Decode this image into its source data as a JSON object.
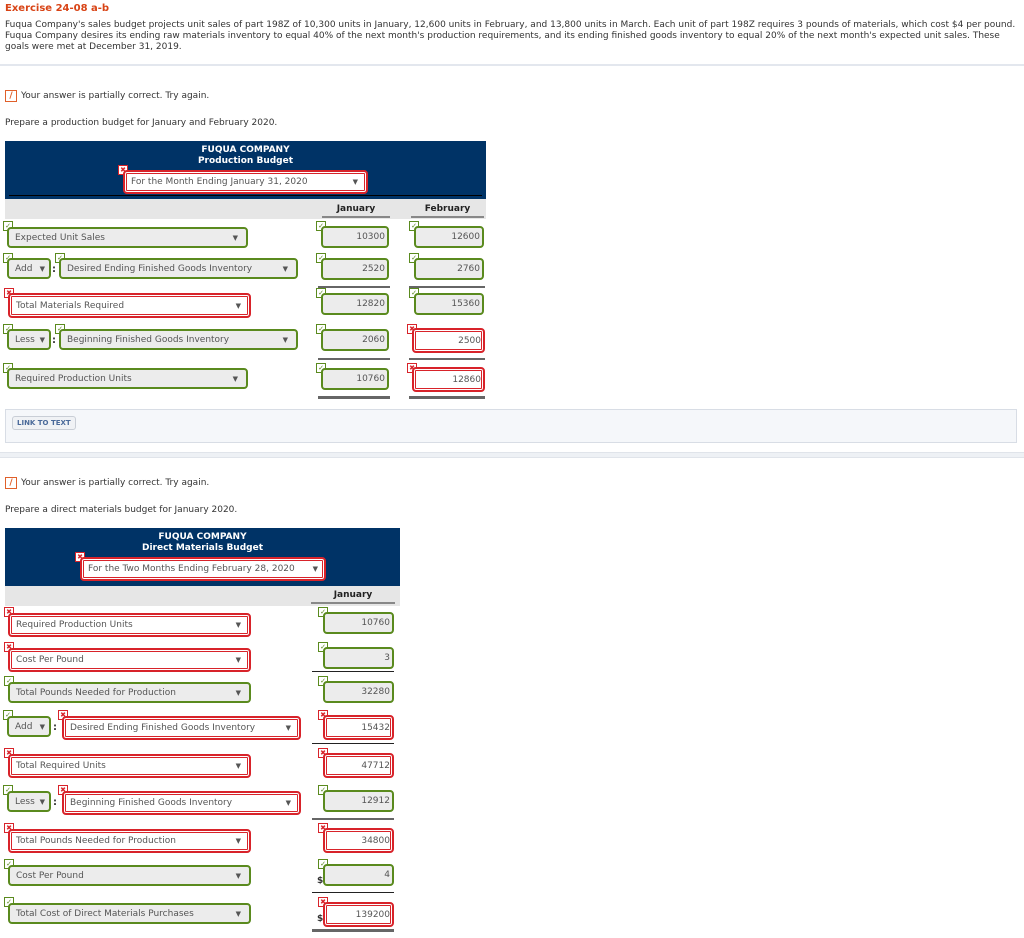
{
  "exercise": {
    "title": "Exercise 24-08 a-b",
    "body": "Fuqua Company's sales budget projects unit sales of part 198Z of 10,300 units in January, 12,600 units in February, and 13,800 units in March. Each unit of part 198Z requires 3 pounds of materials, which cost $4 per pound. Fuqua Company desires its ending raw materials inventory to equal 40% of the next month's production requirements, and its ending finished goods inventory to equal 20% of the next month's expected unit sales. These goals were met at December 31, 2019."
  },
  "part_a": {
    "status": "Your answer is partially correct.  Try again.",
    "prompt": "Prepare a production budget for January and February 2020.",
    "company": "FUQUA COMPANY",
    "budget_title": "Production Budget",
    "period_select": "For the Month Ending January 31, 2020",
    "period_correct": false,
    "columns": [
      "January",
      "February"
    ],
    "rows": [
      {
        "label": "Expected Unit Sales",
        "label_ok": true,
        "values": [
          "10300",
          "12600"
        ],
        "values_ok": [
          true,
          true
        ]
      },
      {
        "prefix": "Add",
        "prefix_ok": true,
        "label": "Desired Ending Finished Goods Inventory",
        "label_ok": true,
        "values": [
          "2520",
          "2760"
        ],
        "values_ok": [
          true,
          true
        ]
      },
      {
        "label": "Total Materials Required",
        "label_ok": false,
        "values": [
          "12820",
          "15360"
        ],
        "values_ok": [
          true,
          true
        ]
      },
      {
        "prefix": "Less",
        "prefix_ok": true,
        "label": "Beginning Finished Goods Inventory",
        "label_ok": true,
        "values": [
          "2060",
          "2500"
        ],
        "values_ok": [
          true,
          false
        ]
      },
      {
        "label": "Required Production Units",
        "label_ok": true,
        "values": [
          "10760",
          "12860"
        ],
        "values_ok": [
          true,
          false
        ]
      }
    ],
    "link_to_text": "LINK TO TEXT"
  },
  "part_b": {
    "status": "Your answer is partially correct.  Try again.",
    "prompt": "Prepare a direct materials budget for January 2020.",
    "company": "FUQUA COMPANY",
    "budget_title": "Direct Materials Budget",
    "period_select": "For the Two Months Ending February 28, 2020",
    "period_correct": false,
    "columns": [
      "January"
    ],
    "currency_symbol": "$",
    "rows": [
      {
        "label": "Required Production Units",
        "label_ok": false,
        "value": "10760",
        "value_ok": true
      },
      {
        "label": "Cost Per Pound",
        "label_ok": false,
        "value": "3",
        "value_ok": true
      },
      {
        "label": "Total Pounds Needed for Production",
        "label_ok": true,
        "value": "32280",
        "value_ok": true
      },
      {
        "prefix": "Add",
        "prefix_ok": true,
        "label": "Desired Ending Finished Goods Inventory",
        "label_ok": false,
        "value": "15432",
        "value_ok": false
      },
      {
        "label": "Total Required Units",
        "label_ok": false,
        "value": "47712",
        "value_ok": false
      },
      {
        "prefix": "Less",
        "prefix_ok": true,
        "label": "Beginning Finished Goods Inventory",
        "label_ok": false,
        "value": "12912",
        "value_ok": true
      },
      {
        "label": "Total Pounds Needed for Production",
        "label_ok": false,
        "value": "34800",
        "value_ok": false
      },
      {
        "label": "Cost Per Pound",
        "label_ok": true,
        "value": "4",
        "value_ok": true,
        "dollar": true
      },
      {
        "label": "Total Cost of Direct Materials Purchases",
        "label_ok": true,
        "value": "139200",
        "value_ok": false,
        "dollar": true
      }
    ]
  },
  "icons": {
    "check": "✓",
    "cross": "✖",
    "pencil": "/",
    "dropdown": "▼"
  },
  "colors": {
    "title_orange": "#d84315",
    "header_navy": "#003366",
    "correct_green": "#5a8a1e",
    "incorrect_red": "#d8232a"
  }
}
